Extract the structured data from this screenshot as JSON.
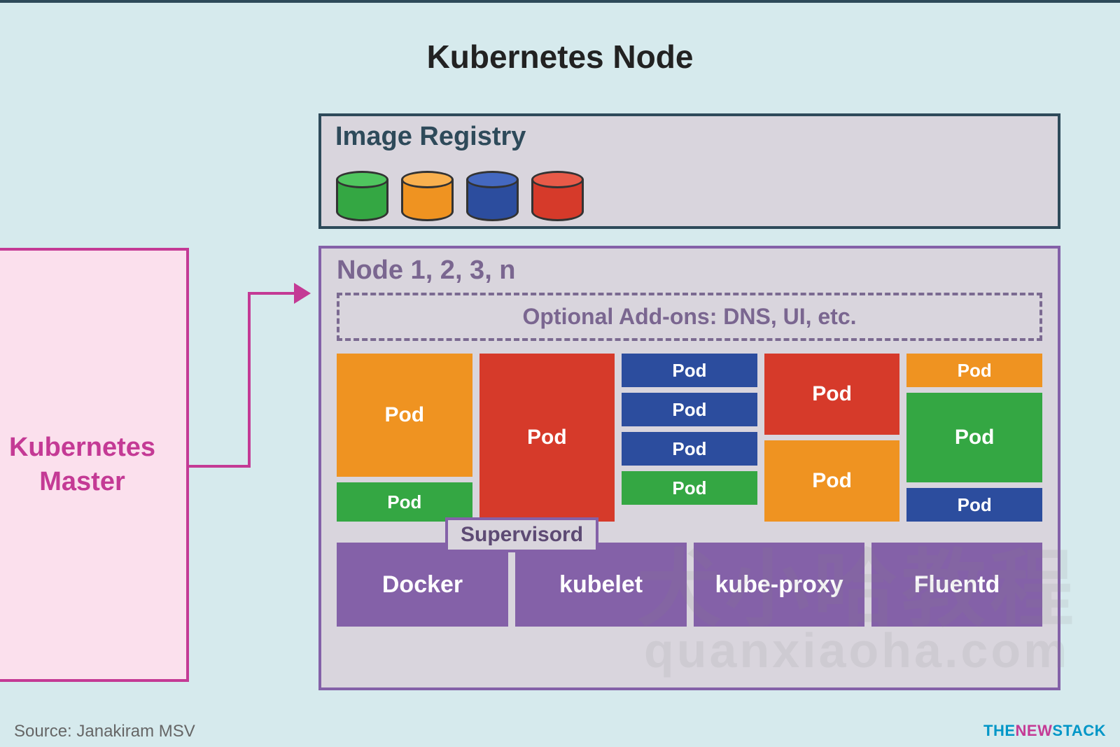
{
  "title": "Kubernetes Node",
  "master": {
    "label": "Kubernetes\nMaster"
  },
  "registry": {
    "title": "Image Registry",
    "images": [
      "green",
      "orange",
      "blue",
      "red"
    ]
  },
  "node": {
    "title": "Node 1, 2, 3, n",
    "addons": "Optional Add-ons: DNS, UI, etc.",
    "columns": [
      {
        "pods": [
          {
            "label": "Pod",
            "color": "orange",
            "size": "lg"
          },
          {
            "label": "Pod",
            "color": "green",
            "size": "med"
          }
        ]
      },
      {
        "pods": [
          {
            "label": "Pod",
            "color": "red",
            "size": "full"
          }
        ]
      },
      {
        "pods": [
          {
            "label": "Pod",
            "color": "blue",
            "size": "sm"
          },
          {
            "label": "Pod",
            "color": "blue",
            "size": "sm"
          },
          {
            "label": "Pod",
            "color": "blue",
            "size": "sm"
          },
          {
            "label": "Pod",
            "color": "green",
            "size": "sm"
          }
        ]
      },
      {
        "pods": [
          {
            "label": "Pod",
            "color": "red",
            "size": "lg"
          },
          {
            "label": "Pod",
            "color": "orange",
            "size": "lg"
          }
        ]
      },
      {
        "pods": [
          {
            "label": "Pod",
            "color": "orange",
            "size": "sm"
          },
          {
            "label": "Pod",
            "color": "green",
            "size": "lg"
          },
          {
            "label": "Pod",
            "color": "blue",
            "size": "sm"
          }
        ]
      }
    ],
    "supervisord": "Supervisord",
    "services": [
      "Docker",
      "kubelet",
      "kube-proxy",
      "Fluentd"
    ]
  },
  "source": "Source: Janakiram MSV",
  "brand": {
    "the": "THE",
    "new": "NEW",
    "stack": "STACK"
  },
  "watermark": {
    "line1": "犬小哈教程",
    "line2": "quanxiaoha.com"
  }
}
